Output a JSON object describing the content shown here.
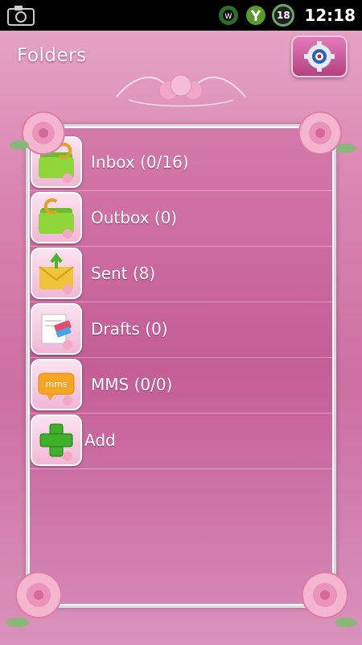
{
  "status_bar": {
    "time": "12:18",
    "battery": "18"
  },
  "header": {
    "title": "Folders"
  },
  "folders": [
    {
      "label": "Inbox (0/16)",
      "icon": "folder-icon"
    },
    {
      "label": "Outbox (0)",
      "icon": "folder-icon"
    },
    {
      "label": "Sent (8)",
      "icon": "envelope-icon"
    },
    {
      "label": "Drafts (0)",
      "icon": "draft-icon"
    },
    {
      "label": "MMS (0/0)",
      "icon": "mms-icon"
    },
    {
      "label": "Add",
      "icon": "plus-icon"
    }
  ],
  "colors": {
    "accent": "#c45d96",
    "background": "#d985b0",
    "status_bar": "#000000"
  }
}
